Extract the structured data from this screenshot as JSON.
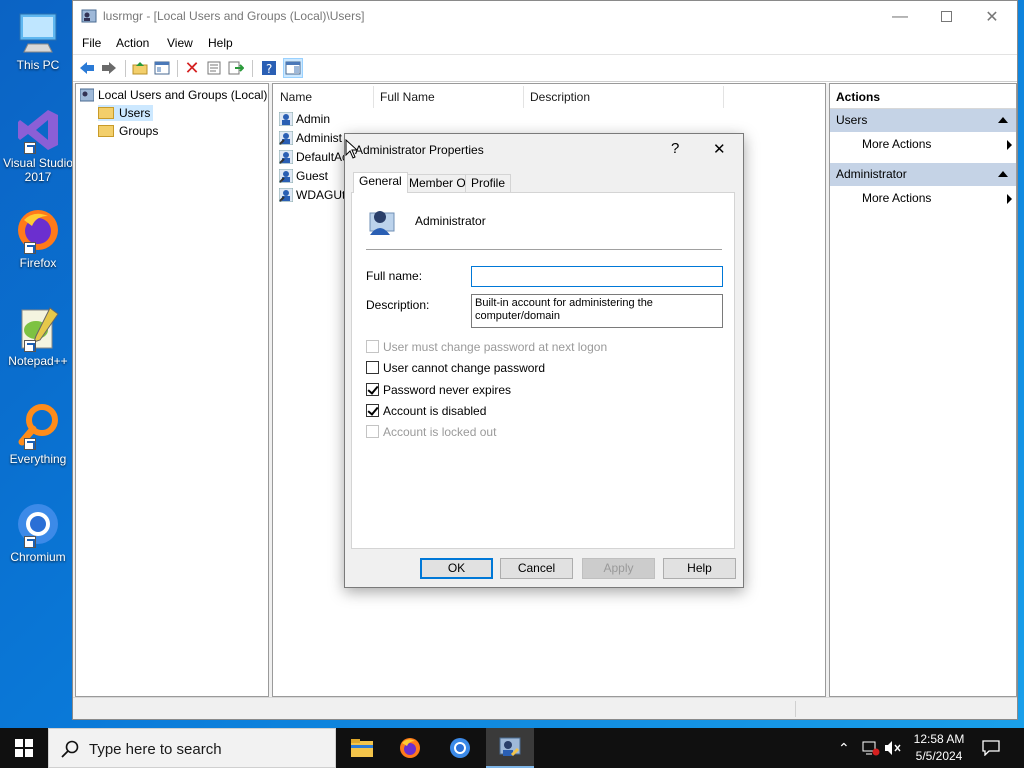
{
  "desktop": {
    "icons": [
      {
        "label": "This PC"
      },
      {
        "label": "Visual Studio 2017"
      },
      {
        "label": "Firefox"
      },
      {
        "label": "Notepad++"
      },
      {
        "label": "Everything"
      },
      {
        "label": "Chromium"
      }
    ]
  },
  "window": {
    "title": "lusrmgr - [Local Users and Groups (Local)\\Users]",
    "menu": [
      "File",
      "Action",
      "View",
      "Help"
    ]
  },
  "tree": {
    "root": "Local Users and Groups (Local)",
    "items": [
      "Users",
      "Groups"
    ]
  },
  "list": {
    "columns": [
      "Name",
      "Full Name",
      "Description"
    ],
    "rows": [
      "Admin",
      "Administ",
      "DefaultAc",
      "Guest",
      "WDAGUti"
    ]
  },
  "actions": {
    "title": "Actions",
    "sections": [
      {
        "header": "Users",
        "item": "More Actions"
      },
      {
        "header": "Administrator",
        "item": "More Actions"
      }
    ]
  },
  "dialog": {
    "title": "Administrator Properties",
    "help_glyph": "?",
    "close_glyph": "✕",
    "tabs": [
      "General",
      "Member Of",
      "Profile"
    ],
    "user_name": "Administrator",
    "full_name_label": "Full name:",
    "full_name_value": "",
    "description_label": "Description:",
    "description_value": "Built-in account for administering the computer/domain",
    "checkboxes": [
      {
        "label": "User must change password at next logon",
        "checked": false,
        "disabled": true
      },
      {
        "label": "User cannot change password",
        "checked": false,
        "disabled": false
      },
      {
        "label": "Password never expires",
        "checked": true,
        "disabled": false
      },
      {
        "label": "Account is disabled",
        "checked": true,
        "disabled": false
      },
      {
        "label": "Account is locked out",
        "checked": false,
        "disabled": true
      }
    ],
    "buttons": {
      "ok": "OK",
      "cancel": "Cancel",
      "apply": "Apply",
      "help": "Help"
    }
  },
  "taskbar": {
    "search_placeholder": "Type here to search",
    "time": "12:58 AM",
    "date": "5/5/2024"
  },
  "colors": {
    "accent": "#0078d7",
    "actions_header": "#c5d3e6",
    "selected_item": "#cce8ff",
    "taskbar": "#101010"
  }
}
